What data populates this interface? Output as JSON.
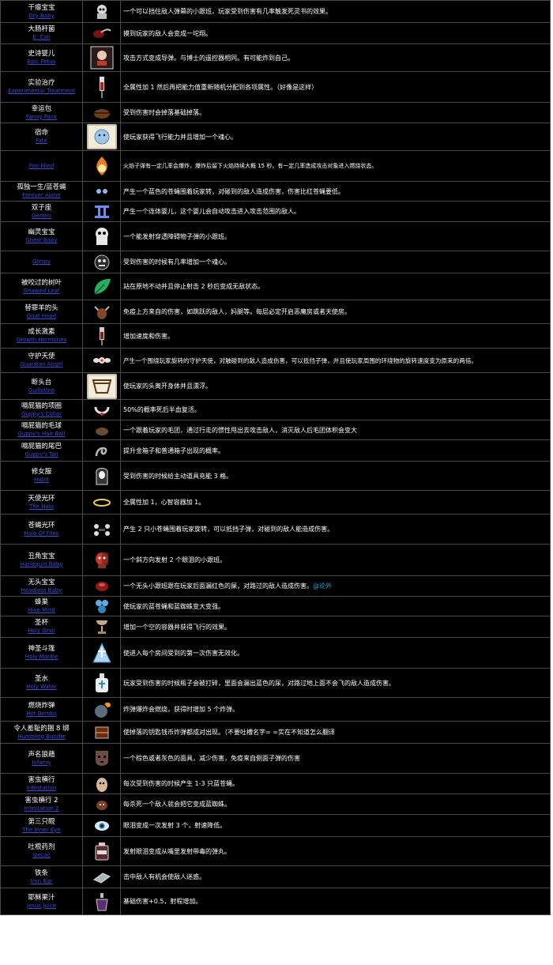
{
  "rows": [
    {
      "cn": "干瘪宝宝",
      "en": "Dry Baby",
      "desc": "一个可以挡住敌人弹幕的小跟班，玩家受到伤害有几率触发死灵书的效果。",
      "icon": "dry-baby-icon"
    },
    {
      "cn": "大肠杆菌",
      "en": "E. Coli",
      "desc": "摸到玩家的敌人会变成一坨翔。",
      "icon": "e-coli-icon"
    },
    {
      "cn": "史诗婴儿",
      "en": "Epic Fetus",
      "desc": "攻击方式变成导弹。与博士的遥控器相同。有可能炸到自己。",
      "icon": "epic-fetus-icon"
    },
    {
      "cn": "实验治疗",
      "en": "Experimental Treatment",
      "desc": "全属性加 1 然后再把能力值重新随机分配到各项属性。（好像是这样）",
      "icon": "experimental-treatment-icon"
    },
    {
      "cn": "幸运包",
      "en": "Fanny Pack",
      "desc": "受到伤害时会掉落基础掉落。",
      "icon": "fanny-pack-icon"
    },
    {
      "cn": "宿命",
      "en": "Fate",
      "desc": "使玩家获得飞行能力并且增加一个魂心。",
      "icon": "fate-icon"
    },
    {
      "cn": "",
      "en": "Fire Mind",
      "desc": "火焰子弹有一定几率会爆炸，爆炸后留下火焰持续大概 15 秒。有一定几率造成攻击对象进入燃烧状态。",
      "icon": "fire-mind-icon"
    },
    {
      "cn": "孤独一生/蓝苍蝇",
      "en": "Forever Alone",
      "desc": "产生一个蓝色的苍蝇围着玩家转，对碰到的敌人造成伤害，伤害比红苍蝇要低。",
      "icon": "forever-alone-icon"
    },
    {
      "cn": "双子座",
      "en": "Gemini",
      "desc": "产生一个连体婴儿，这个婴儿会自动攻击进入攻击范围的敌人。",
      "icon": "gemini-icon"
    },
    {
      "cn": "幽灵宝宝",
      "en": "Ghost Baby",
      "desc": "一个能发射穿透障碍物子弹的小跟班。",
      "icon": "ghost-baby-icon"
    },
    {
      "cn": "",
      "en": "Gimpy",
      "desc": "受到伤害的时候有几率增加一个魂心。",
      "icon": "gimpy-icon"
    },
    {
      "cn": "被咬过的树叶",
      "en": "Gnawed Leaf",
      "desc": "站在原地不动并且停止射击 2 秒后变成无敌状态。",
      "icon": "gnawed-leaf-icon"
    },
    {
      "cn": "替罪羊的头",
      "en": "Goat Head",
      "desc": "免疫上方来自的伤害，如跳跃的敌人，妈腿等。每层必定开启恶魔房或者天使房。",
      "icon": "goat-head-icon"
    },
    {
      "cn": "成长激素",
      "en": "Growth Hormones",
      "desc": "增加速度和伤害。",
      "icon": "growth-hormones-icon"
    },
    {
      "cn": "守护天使",
      "en": "Guardian Angel",
      "desc": "产生一个围绕玩家旋转的守护天使，对触碰到的敌人造成伤害，可以抵挡子弹，并且使玩家周围的环绕物的旋转速度变为原来的两倍。",
      "icon": "guardian-angel-icon"
    },
    {
      "cn": "断头台",
      "en": "Guillotine",
      "desc": "使玩家的头离开身体并且漂浮。",
      "icon": "guillotine-icon"
    },
    {
      "cn": "嗝屁猫的项圈",
      "en": "Guppy's Collar",
      "desc": "50%的概率死后半血复活。",
      "icon": "guppys-collar-icon"
    },
    {
      "cn": "嗝屁猫的毛球",
      "en": "Guppy's Hair Ball",
      "desc": "一个跟着玩家的毛团，通过行走的惯性甩出去攻击敌人，消灭敌人后毛团体积会变大",
      "icon": "guppys-hairball-icon"
    },
    {
      "cn": "嗝屁猫的尾巴",
      "en": "Guppy's Tail",
      "desc": "提升金箱子和普通箱子出现的概率。",
      "icon": "guppys-tail-icon"
    },
    {
      "cn": "修女服",
      "en": "Habit",
      "desc": "受到伤害的时候给主动道具充能 3 格。",
      "icon": "habit-icon"
    },
    {
      "cn": "天使光环",
      "en": "The Halo",
      "desc": "全属性加 1，心智容器加 1。",
      "icon": "halo-icon"
    },
    {
      "cn": "苍蝇光环",
      "en": "Halo Of Flies",
      "desc": "产生 2 只小苍蝇围着玩家旋转，可以抵挡子弹，对碰到的敌人能造成伤害。",
      "icon": "halo-of-flies-icon"
    },
    {
      "cn": "丑角宝宝",
      "en": "Harlequin Baby",
      "desc": "一个斜方向发射 2 个眼泪的小跟班。",
      "icon": "harlequin-baby-icon"
    },
    {
      "cn": "无头宝宝",
      "en": "Headless Baby",
      "desc": "一个无头小跟班跟在玩家后面漏红色的屎，对路过的敌人造成伤害。",
      "tag": "@论外",
      "icon": "headless-baby-icon"
    },
    {
      "cn": "蜂巢",
      "en": "Hive Mind",
      "desc": "使玩家的蓝苍蝇和蓝蜘蛛变大变强。",
      "icon": "hive-mind-icon"
    },
    {
      "cn": "圣杯",
      "en": "Holy Grail",
      "desc": "增加一个空的容器并获得飞行的效果。",
      "icon": "holy-grail-icon"
    },
    {
      "cn": "神圣斗篷",
      "en": "Holy Mantle",
      "desc": "使进入每个房间受到的第一次伤害无效化。",
      "icon": "holy-mantle-icon"
    },
    {
      "cn": "圣水",
      "en": "Holy Water",
      "desc": "玩家受到伤害的时候瓶子会被打碎，里面会漏出蓝色的尿，对路过地上面不会飞的敌人造成伤害。",
      "icon": "holy-water-icon"
    },
    {
      "cn": "燃烧炸弹",
      "en": "Hot Bombs",
      "desc": "炸弹爆炸会燃烧，获得时增加 5 个炸弹。",
      "icon": "hot-bombs-icon"
    },
    {
      "cn": "令人羞耻的捆 8 绑",
      "en": "Humbling Bundle",
      "desc": "使掉落的钥匙钱币炸弹都成对出现。（不要吐槽名字= =实在不知道怎么翻译",
      "icon": "humbling-bundle-icon"
    },
    {
      "cn": "声名狼藉",
      "en": "Infamy",
      "desc": "一个棕色或者灰色的面具，减少伤害，免疫来自侧面子弹的伤害",
      "icon": "infamy-icon"
    },
    {
      "cn": "害虫横行",
      "en": "Infestation",
      "desc": "每次受到伤害的时候产生 1-3 只蓝苍蝇。",
      "icon": "infestation-icon"
    },
    {
      "cn": "害虫横行 2",
      "en": "Infestation 2",
      "desc": "每杀死一个敌人就会把它变成蓝蜘蛛。",
      "icon": "infestation-2-icon"
    },
    {
      "cn": "第三只眼",
      "en": "The Inner Eye",
      "desc": "眼泪变成一次发射 3 个，射速降低。",
      "icon": "inner-eye-icon"
    },
    {
      "cn": "吐根药剂",
      "en": "Ipecac",
      "desc": "发射眼泪变成从嘴里发射带毒的弹丸。",
      "icon": "ipecac-icon"
    },
    {
      "cn": "铁条",
      "en": "Iron Bar",
      "desc": "击中敌人有机会使敌人迷惑。",
      "icon": "iron-bar-icon"
    },
    {
      "cn": "耶稣果汁",
      "en": "Jesus Juice",
      "desc": "基础伤害+0.5，射程增加。",
      "icon": "jesus-juice-icon"
    }
  ]
}
